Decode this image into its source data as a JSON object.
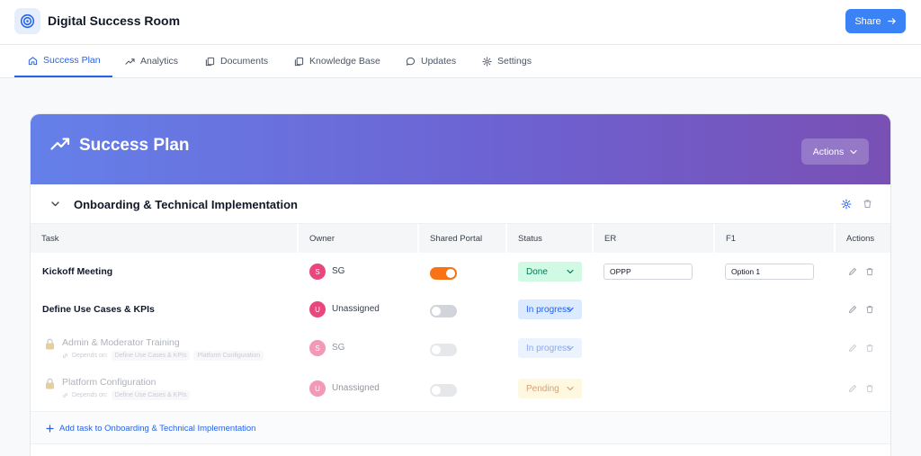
{
  "app": {
    "title": "Digital Success Room",
    "share_label": "Share"
  },
  "tabs": [
    {
      "label": "Success Plan",
      "icon": "home-icon",
      "active": true
    },
    {
      "label": "Analytics",
      "icon": "trending-up-icon",
      "active": false
    },
    {
      "label": "Documents",
      "icon": "documents-icon",
      "active": false
    },
    {
      "label": "Knowledge Base",
      "icon": "copy-icon",
      "active": false
    },
    {
      "label": "Updates",
      "icon": "chat-bubble-icon",
      "active": false
    },
    {
      "label": "Settings",
      "icon": "gear-icon",
      "active": false
    }
  ],
  "plan": {
    "title": "Success Plan",
    "actions_label": "Actions"
  },
  "section": {
    "title": "Onboarding & Technical Implementation",
    "add_task_label": "Add task to Onboarding & Technical Implementation"
  },
  "columns": [
    "Task",
    "Owner",
    "Shared Portal",
    "Status",
    "ER",
    "F1",
    "Actions"
  ],
  "tasks": [
    {
      "name": "Kickoff Meeting",
      "locked": false,
      "owner_initial": "S",
      "owner": "SG",
      "shared": true,
      "status": "Done",
      "er": "OPPP",
      "f1": "Option 1"
    },
    {
      "name": "Define Use Cases & KPIs",
      "locked": false,
      "owner_initial": "U",
      "owner": "Unassigned",
      "shared": false,
      "status": "In progress"
    },
    {
      "name": "Admin & Moderator Training",
      "locked": true,
      "depends_label": "Depends on:",
      "depends": [
        "Define Use Cases & KPIs",
        "Platform Configuration"
      ],
      "owner_initial": "S",
      "owner": "SG",
      "shared": false,
      "status": "In progress"
    },
    {
      "name": "Platform Configuration",
      "locked": true,
      "depends_label": "Depends on:",
      "depends": [
        "Define Use Cases & KPIs"
      ],
      "owner_initial": "U",
      "owner": "Unassigned",
      "shared": false,
      "status": "Pending"
    }
  ],
  "colors": {
    "accent": "#3b82f6",
    "hero_start": "#6580e9",
    "hero_end": "#7950b4",
    "toggle_on": "#f97316",
    "avatar": "#e8467c"
  }
}
